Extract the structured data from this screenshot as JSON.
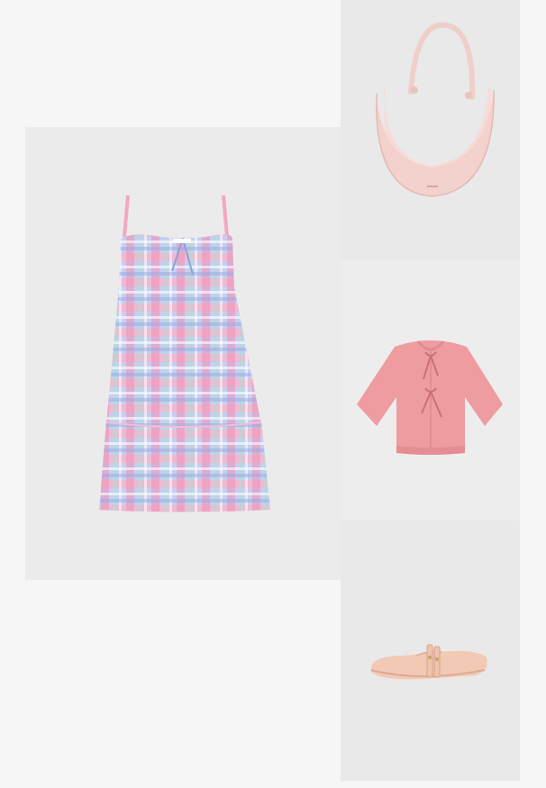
{
  "page": {
    "background": "#f6f6f6"
  },
  "products": [
    {
      "id": "dress",
      "icon": "plaid-tiered-sundress",
      "colors": [
        "#f29abb",
        "#a9b8e3",
        "#ffffff"
      ]
    },
    {
      "id": "bag",
      "icon": "crescent-shoulder-bag",
      "colors": [
        "#f6d9d6"
      ]
    },
    {
      "id": "cardigan",
      "icon": "tie-front-short-cardigan",
      "colors": [
        "#ee9b9f"
      ]
    },
    {
      "id": "shoes",
      "icon": "mary-jane-ballet-flats",
      "colors": [
        "#f2c9b4"
      ]
    }
  ]
}
